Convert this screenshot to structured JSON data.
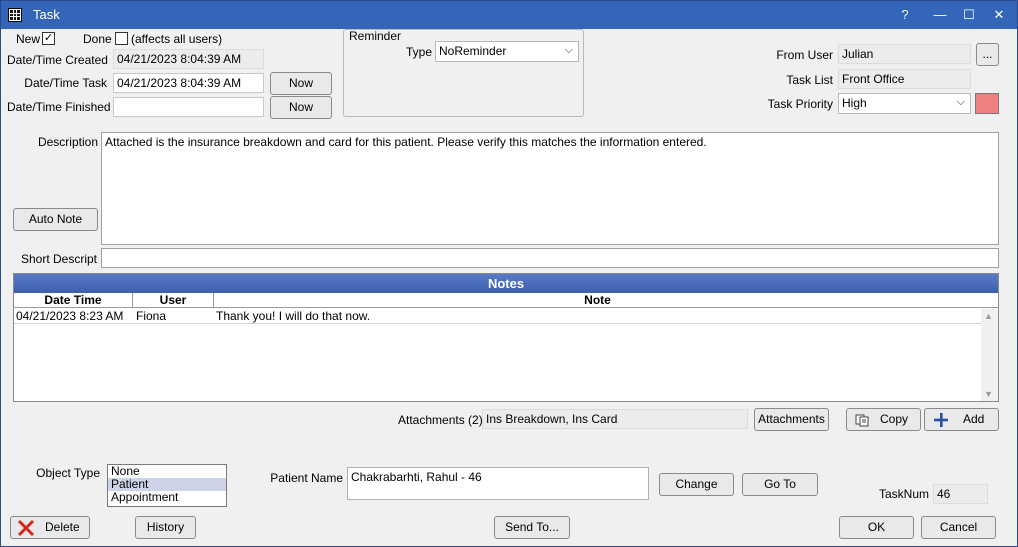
{
  "window": {
    "title": "Task",
    "help": "?",
    "minimize": "—",
    "maximize": "☐",
    "close": "✕"
  },
  "top": {
    "new_label": "New",
    "new_checked": "✓",
    "done_label": "Done",
    "done_checked": "",
    "affects_all": "(affects all users)",
    "created_label": "Date/Time Created",
    "created_value": "04/21/2023 8:04:39 AM",
    "task_label": "Date/Time Task",
    "task_value": "04/21/2023 8:04:39 AM",
    "finished_label": "Date/Time Finished",
    "finished_value": "",
    "now_label": "Now"
  },
  "reminder": {
    "group_label": "Reminder",
    "type_label": "Type",
    "type_value": "NoReminder"
  },
  "right": {
    "from_user_label": "From User",
    "from_user_value": "Julian",
    "ellipsis": "...",
    "task_list_label": "Task List",
    "task_list_value": "Front Office",
    "priority_label": "Task Priority",
    "priority_value": "High",
    "priority_color": "#f08080"
  },
  "description": {
    "label": "Description",
    "value": "Attached is the insurance breakdown and card for this patient. Please verify this matches the information entered.",
    "auto_note": "Auto Note",
    "short_label": "Short Descript",
    "short_value": ""
  },
  "notes": {
    "title": "Notes",
    "columns": [
      "Date Time",
      "User",
      "Note"
    ],
    "rows": [
      {
        "datetime": "04/21/2023 8:23 AM",
        "user": "Fiona",
        "note": "Thank you! I will do that now."
      }
    ]
  },
  "attachments": {
    "label": "Attachments (2)",
    "value": "Ins Breakdown, Ins Card",
    "button": "Attachments",
    "copy": "Copy",
    "add": "Add"
  },
  "object": {
    "type_label": "Object Type",
    "options": [
      "None",
      "Patient",
      "Appointment"
    ],
    "selected": "Patient",
    "patient_label": "Patient Name",
    "patient_value": "Chakrabarhti, Rahul - 46",
    "change": "Change",
    "goto": "Go To",
    "tasknum_label": "TaskNum",
    "tasknum_value": "46"
  },
  "footer": {
    "delete": "Delete",
    "history": "History",
    "send_to": "Send To...",
    "ok": "OK",
    "cancel": "Cancel"
  },
  "icons": {
    "app": "grid-icon",
    "copy": "copy-icon",
    "add": "plus-icon",
    "delete": "red-x-icon"
  }
}
